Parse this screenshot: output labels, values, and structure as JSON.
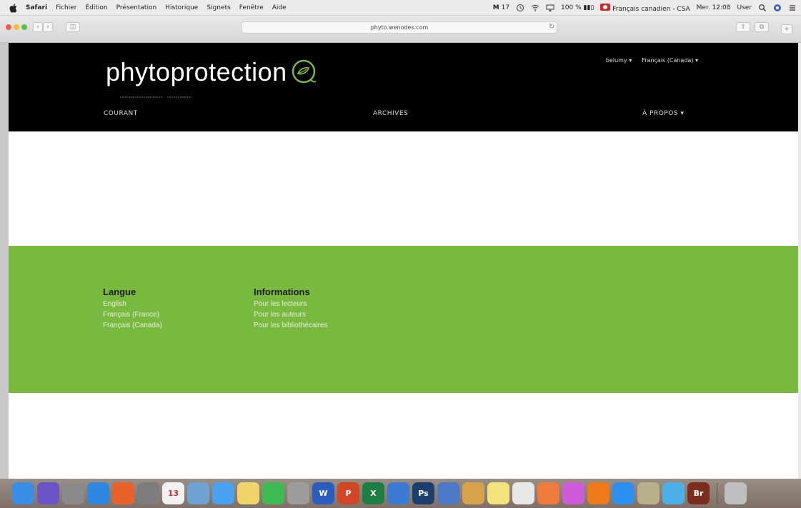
{
  "menubar": {
    "app_name": "Safari",
    "menus": [
      "Fichier",
      "Édition",
      "Présentation",
      "Historique",
      "Signets",
      "Fenêtre",
      "Aide"
    ],
    "status": {
      "mail_count": "17",
      "battery": "100 %",
      "input_source": "Français canadien - CSA",
      "clock": "Mer. 12:08",
      "user": "User"
    }
  },
  "browser": {
    "url": "phyto.wenodes.com"
  },
  "site": {
    "logo_text": "phytoprotection",
    "user_nav": {
      "login_label": "belumy",
      "language_label": "Français (Canada)"
    },
    "primary_nav": {
      "courant": "COURANT",
      "archives": "ARCHIVES",
      "apropos": "À PROPOS"
    },
    "footer": {
      "langue": {
        "heading": "Langue",
        "links": [
          "English",
          "Français (France)",
          "Français (Canada)"
        ]
      },
      "informations": {
        "heading": "Informations",
        "links": [
          "Pour les lecteurs",
          "Pour les auteurs",
          "Pour les bibliothécaires"
        ]
      }
    }
  },
  "colors": {
    "header_bg": "#000000",
    "footer_bg": "#7ab93f",
    "logo_leaf": "#7ab93f"
  },
  "dock": [
    {
      "icon": "finder-icon",
      "color": "#3a8ee6",
      "glyph": ""
    },
    {
      "icon": "siri-icon",
      "color": "#6b53c8",
      "glyph": ""
    },
    {
      "icon": "launchpad-icon",
      "color": "#8a8a8a",
      "glyph": ""
    },
    {
      "icon": "safari-icon",
      "color": "#2f87e0",
      "glyph": ""
    },
    {
      "icon": "firefox-icon",
      "color": "#e8622a",
      "glyph": ""
    },
    {
      "icon": "system-preferences-icon",
      "color": "#7d7d7d",
      "glyph": ""
    },
    {
      "icon": "calendar-icon",
      "color": "#f2f2f2",
      "glyph": "13"
    },
    {
      "icon": "preview-icon",
      "color": "#6fa3d4",
      "glyph": ""
    },
    {
      "icon": "messages-icon",
      "color": "#4aa3f0",
      "glyph": ""
    },
    {
      "icon": "notes-icon",
      "color": "#f0d46a",
      "glyph": ""
    },
    {
      "icon": "facetime-icon",
      "color": "#3dbb53",
      "glyph": ""
    },
    {
      "icon": "trash-bin-icon",
      "color": "#9c9c9c",
      "glyph": ""
    },
    {
      "icon": "word-icon",
      "color": "#2b5dbf",
      "glyph": "W"
    },
    {
      "icon": "powerpoint-icon",
      "color": "#d24726",
      "glyph": "P"
    },
    {
      "icon": "excel-icon",
      "color": "#1e7d43",
      "glyph": "X"
    },
    {
      "icon": "keynote-icon",
      "color": "#3b7bd4",
      "glyph": ""
    },
    {
      "icon": "photoshop-icon",
      "color": "#1c3f6e",
      "glyph": "Ps"
    },
    {
      "icon": "image-capture-icon",
      "color": "#4e79c6",
      "glyph": ""
    },
    {
      "icon": "photos-app-icon",
      "color": "#d8a24d",
      "glyph": ""
    },
    {
      "icon": "stickies-icon",
      "color": "#f4e27a",
      "glyph": ""
    },
    {
      "icon": "textedit-icon",
      "color": "#e8e8e8",
      "glyph": ""
    },
    {
      "icon": "photos-icon",
      "color": "#ee7b3b",
      "glyph": ""
    },
    {
      "icon": "itunes-icon",
      "color": "#d05bd8",
      "glyph": ""
    },
    {
      "icon": "ibooks-icon",
      "color": "#f07a1a",
      "glyph": ""
    },
    {
      "icon": "app-store-icon",
      "color": "#2d8ff0",
      "glyph": ""
    },
    {
      "icon": "sketch-icon",
      "color": "#b8b08a",
      "glyph": ""
    },
    {
      "icon": "activity-icon",
      "color": "#4db0e6",
      "glyph": ""
    },
    {
      "icon": "bridge-icon",
      "color": "#7c2d1d",
      "glyph": "Br"
    },
    {
      "icon": "trash-icon",
      "color": "#bfbfbf",
      "glyph": ""
    }
  ]
}
